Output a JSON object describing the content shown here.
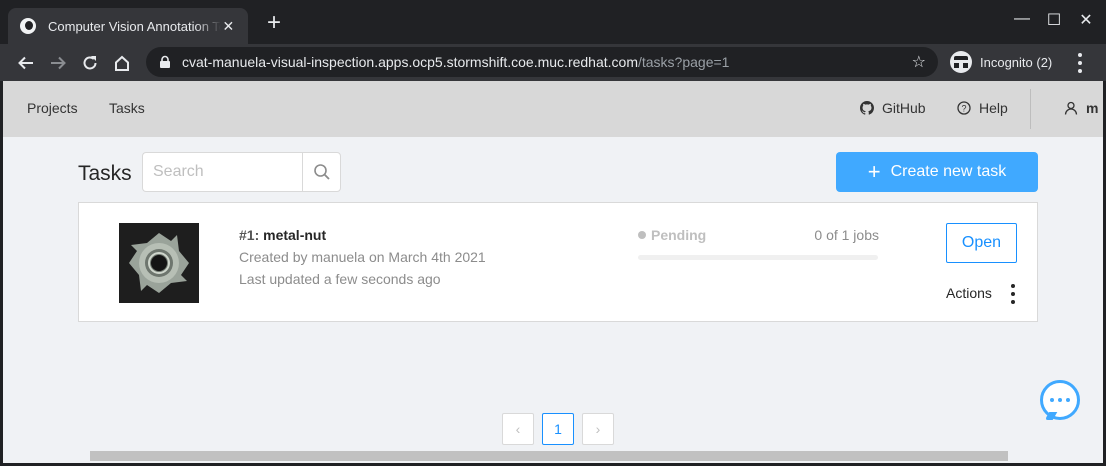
{
  "browser": {
    "tab_title": "Computer Vision Annotation Tool",
    "tab_close": "✕",
    "new_tab": "+",
    "window_controls": {
      "minimize": "—",
      "maximize": "☐",
      "close": "✕"
    },
    "url_host": "cvat-manuela-visual-inspection.apps.ocp5.stormshift.coe.muc.redhat.com",
    "url_path": "/tasks?page=1",
    "incognito_label": "Incognito (2)",
    "icons": [
      "back-icon",
      "forward-icon",
      "reload-icon",
      "home-icon",
      "lock-icon",
      "star-icon",
      "incognito-icon",
      "menu-icon"
    ]
  },
  "header": {
    "nav": [
      "Projects",
      "Tasks"
    ],
    "github": "GitHub",
    "help": "Help",
    "user_initial": "m"
  },
  "tasks_page": {
    "title": "Tasks",
    "search_placeholder": "Search",
    "create_button": "Create new task",
    "create_icon": "+"
  },
  "task": {
    "id": "#1:",
    "name": "metal-nut",
    "created": "Created by manuela on March 4th 2021",
    "updated": "Last updated a few seconds ago",
    "status": "Pending",
    "jobs": "0 of 1 jobs",
    "progress": 0,
    "open_button": "Open",
    "actions_label": "Actions"
  },
  "pagination": {
    "prev": "‹",
    "current": "1",
    "next": "›"
  },
  "colors": {
    "primary": "#40a9ff",
    "link": "#1890ff",
    "header_bg": "#d8d8d8",
    "page_bg": "#f0f2f5"
  }
}
